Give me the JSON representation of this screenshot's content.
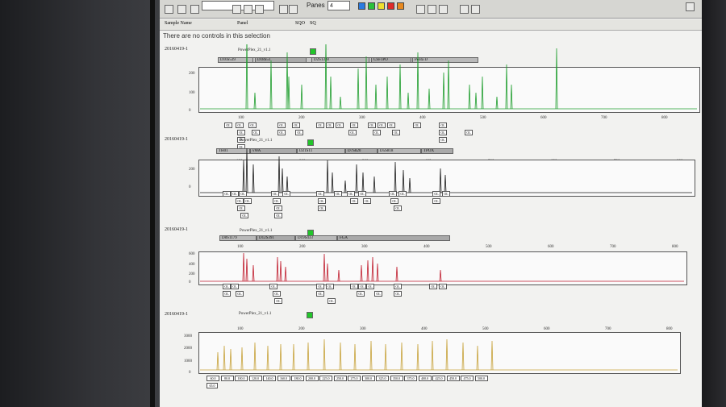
{
  "toolbar": {
    "panes_label": "Panes",
    "panes_value": "4"
  },
  "header": {
    "sample_name": "Sample Name",
    "panel": "Panel",
    "sqo": "SQO",
    "sq": "SQ"
  },
  "notice": "There are no controls in this selection",
  "ol_label": "OL",
  "panels": [
    {
      "sample": "20160419-1",
      "panel_name": "PowerPlex_21_v1.1",
      "color": "#1f9e2e",
      "ticks": [
        "100",
        "200",
        "300",
        "400",
        "500",
        "600",
        "700",
        "800"
      ],
      "yticks": [
        "200",
        "100",
        "0"
      ],
      "loci": [
        "D16S539",
        "D18S51",
        "D2S1338",
        "CSF1PO",
        "Penta D"
      ]
    },
    {
      "sample": "20160419-1",
      "panel_name": "PowerPlex_21_v1.1",
      "color": "#1a1a1a",
      "ticks": [
        "100",
        "200",
        "300",
        "400",
        "500",
        "600",
        "700",
        "800"
      ],
      "yticks": [
        "200",
        "0"
      ],
      "loci": [
        "TH01",
        "vWA",
        "D21S11",
        "D7S820",
        "D5S818",
        "TPOX"
      ]
    },
    {
      "sample": "20160419-1",
      "panel_name": "PowerPlex_21_v1.1",
      "color": "#c01d2e",
      "ticks": [
        "100",
        "200",
        "300",
        "400",
        "500",
        "600",
        "700",
        "800"
      ],
      "yticks": [
        "600",
        "400",
        "200",
        "0"
      ],
      "loci": [
        "D8S1179",
        "D12S391",
        "D19S433",
        "FGA"
      ]
    },
    {
      "sample": "20160419-1",
      "panel_name": "PowerPlex_21_v1.1",
      "color": "#c7a23a",
      "ticks": [
        "100",
        "200",
        "300",
        "400",
        "500",
        "600",
        "700",
        "800"
      ],
      "yticks": [
        "3000",
        "2000",
        "1000",
        "0"
      ],
      "loci": [],
      "sizes": [
        "60.0",
        "80.0",
        "100.0",
        "120.0",
        "140.0",
        "160.0",
        "180.0",
        "200.0",
        "225.0",
        "250.0",
        "275.0",
        "300.0",
        "325.0",
        "350.0",
        "375.0",
        "400.0",
        "425.0",
        "450.0",
        "475.0",
        "500.0"
      ],
      "first_size": "65.0"
    }
  ]
}
